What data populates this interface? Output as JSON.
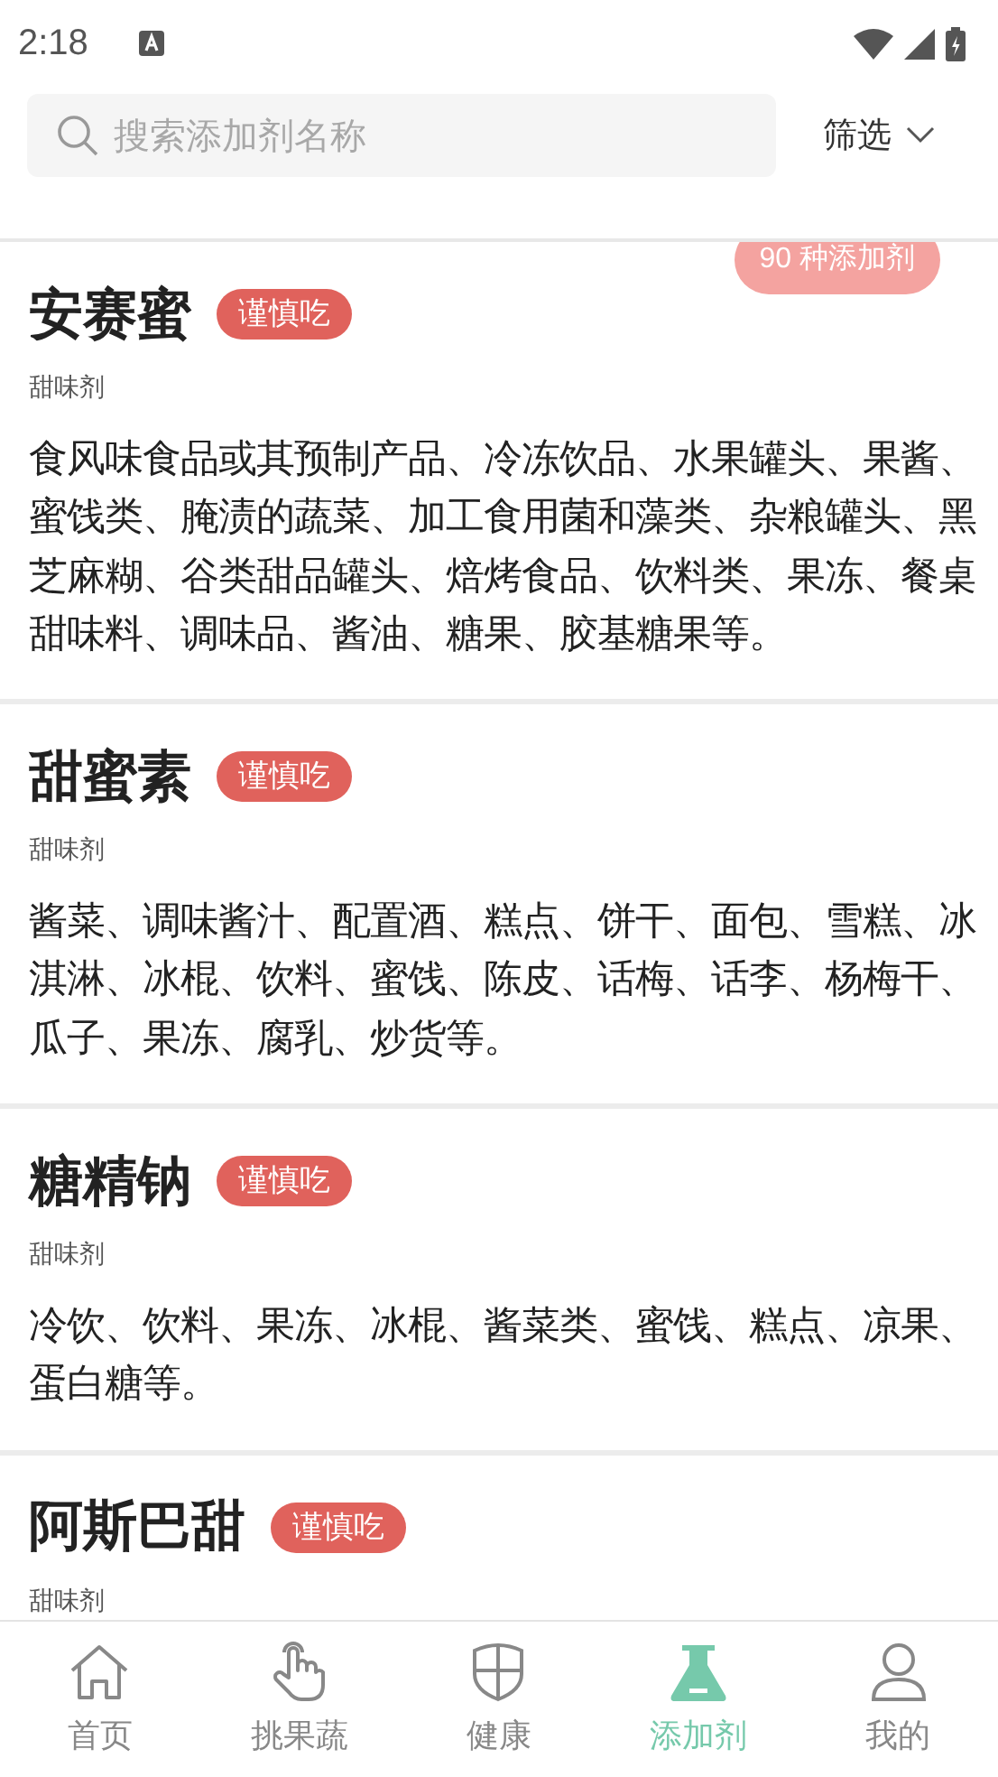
{
  "status_bar": {
    "time": "2:18"
  },
  "search": {
    "placeholder": "搜索添加剂名称"
  },
  "filter": {
    "label": "筛选"
  },
  "count_badge": "90 种添加剂",
  "additives": [
    {
      "name": "安赛蜜",
      "tag": "谨慎吃",
      "category": "甜味剂",
      "uses": "食风味食品或其预制产品、冷冻饮品、水果罐头、果酱、蜜饯类、腌渍的蔬菜、加工食用菌和藻类、杂粮罐头、黑芝麻糊、谷类甜品罐头、焙烤食品、饮料类、果冻、餐桌甜味料、调味品、酱油、糖果、胶基糖果等。"
    },
    {
      "name": "甜蜜素",
      "tag": "谨慎吃",
      "category": "甜味剂",
      "uses": "酱菜、调味酱汁、配置酒、糕点、饼干、面包、雪糕、冰淇淋、冰棍、饮料、蜜饯、陈皮、话梅、话李、杨梅干、瓜子、果冻、腐乳、炒货等。"
    },
    {
      "name": "糖精钠",
      "tag": "谨慎吃",
      "category": "甜味剂",
      "uses": "冷饮、饮料、果冻、冰棍、酱菜类、蜜饯、糕点、凉果、蛋白糖等。"
    },
    {
      "name": "阿斯巴甜",
      "tag": "谨慎吃",
      "category": "甜味剂"
    }
  ],
  "tab_bar": [
    {
      "label": "首页",
      "selected": false
    },
    {
      "label": "挑果蔬",
      "selected": false
    },
    {
      "label": "健康",
      "selected": false
    },
    {
      "label": "添加剂",
      "selected": true
    },
    {
      "label": "我的",
      "selected": false
    }
  ]
}
